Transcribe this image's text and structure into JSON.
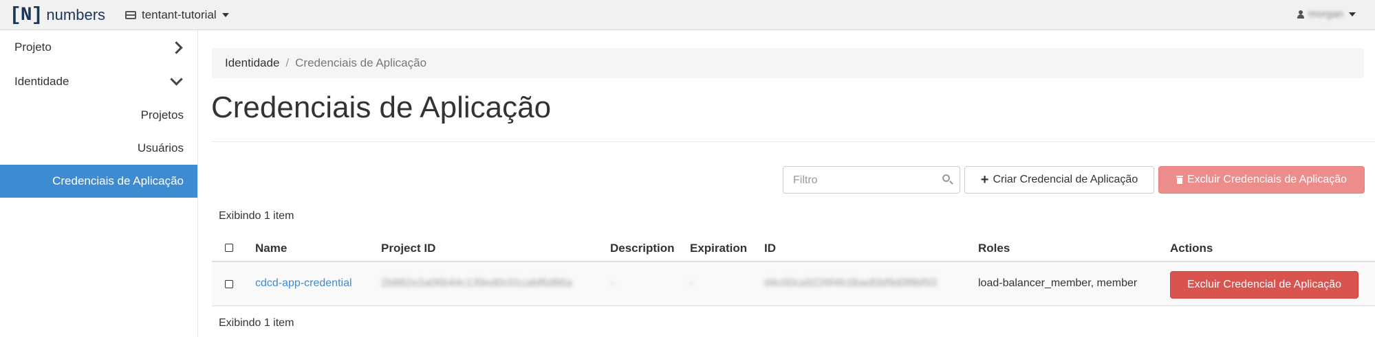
{
  "topbar": {
    "logo_mark": "[N]",
    "logo_text": "numbers",
    "project": "tentant-tutorial",
    "user": "morgan"
  },
  "sidebar": {
    "items": [
      {
        "label": "Projeto"
      },
      {
        "label": "Identidade"
      },
      {
        "label": "Projetos"
      },
      {
        "label": "Usuários"
      },
      {
        "label": "Credenciais de Aplicação"
      }
    ]
  },
  "breadcrumb": {
    "parent": "Identidade",
    "separator": "/",
    "current": "Credenciais de Aplicação"
  },
  "page": {
    "title": "Credenciais de Aplicação"
  },
  "toolbar": {
    "filter_placeholder": "Filtro",
    "create_label": "Criar Credencial de Aplicação",
    "delete_all_label": "Excluir Credenciais de Aplicação"
  },
  "table": {
    "count_label": "Exibindo 1 item",
    "headers": {
      "name": "Name",
      "project_id": "Project ID",
      "description": "Description",
      "expiration": "Expiration",
      "id": "ID",
      "roles": "Roles",
      "actions": "Actions"
    },
    "rows": [
      {
        "name": "cdcd-app-credential",
        "project_id": "2b882e2a06b44c139ed0c01cabf6d86a",
        "description": "-",
        "expiration": "-",
        "id": "d4c00ca9226f4fc0bad5bf9d0f8bf93",
        "roles": "load-balancer_member, member",
        "action_label": "Excluir Credencial de Aplicação"
      }
    ]
  },
  "colors": {
    "accent": "#3f8bd2",
    "danger": "#d9534f",
    "danger_disabled": "#ec8d8b"
  }
}
